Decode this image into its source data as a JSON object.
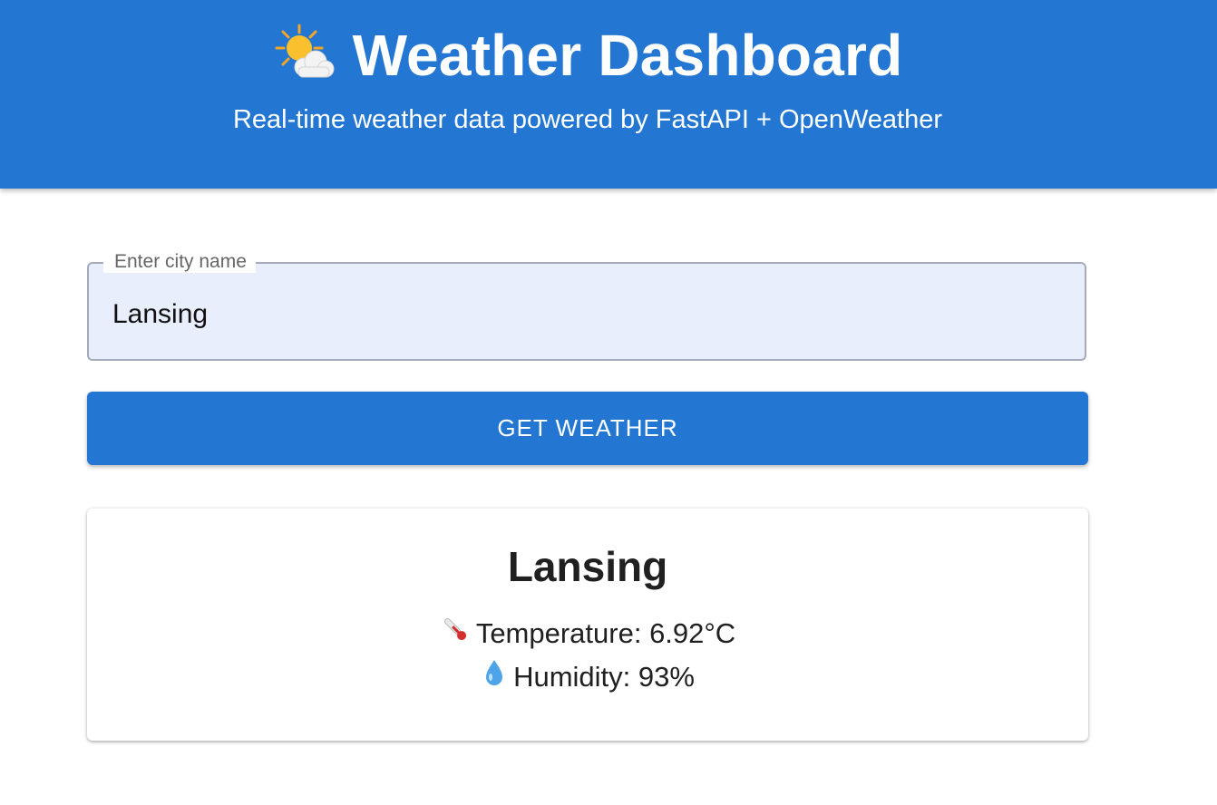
{
  "header": {
    "icon": "sun-behind-cloud-icon",
    "title": "Weather Dashboard",
    "subtitle": "Real-time weather data powered by FastAPI + OpenWeather",
    "background_color": "#2377d2"
  },
  "search": {
    "label": "Enter city name",
    "value": "Lansing",
    "field_background": "#e8eefb"
  },
  "action": {
    "button_label": "GET WEATHER",
    "button_color": "#2377d2"
  },
  "result": {
    "city": "Lansing",
    "temperature_label": "Temperature: 6.92°C",
    "temperature_icon": "thermometer-icon",
    "humidity_label": "Humidity: 93%",
    "humidity_icon": "droplet-icon"
  }
}
